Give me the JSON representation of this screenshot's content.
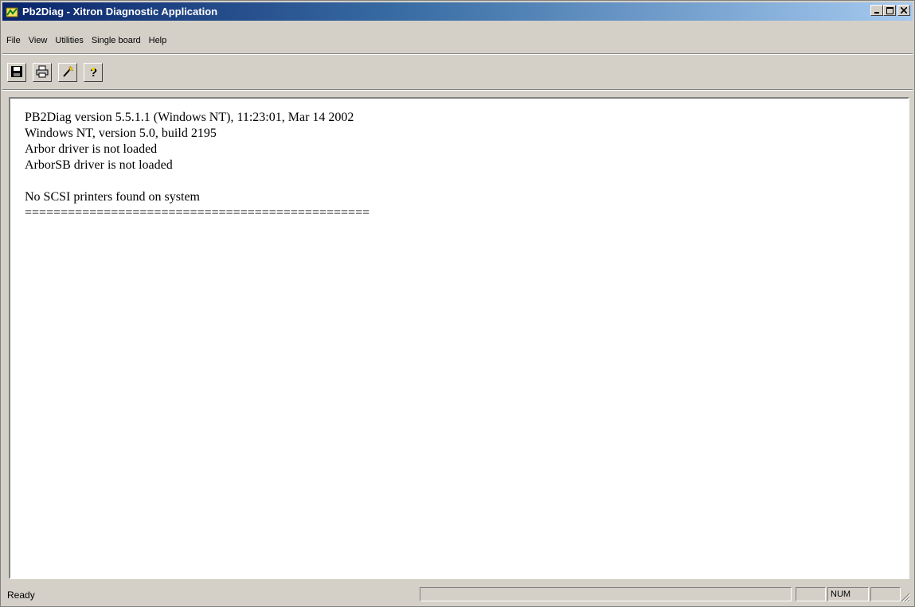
{
  "window": {
    "title": "Pb2Diag - Xitron Diagnostic Application"
  },
  "menu": [
    "File",
    "View",
    "Utilities",
    "Single board",
    "Help"
  ],
  "toolbar": {
    "buttons": [
      "save-icon",
      "print-icon",
      "wand-icon",
      "help-icon"
    ]
  },
  "output": {
    "lines": [
      "PB2Diag version 5.5.1.1 (Windows NT), 11:23:01, Mar 14 2002",
      "Windows NT, version 5.0, build 2195",
      "Arbor driver is not loaded",
      "ArborSB driver is not loaded",
      "",
      "No SCSI printers found on system",
      "================================================"
    ]
  },
  "status": {
    "text": "Ready",
    "num": "NUM"
  },
  "colors": {
    "title_start": "#0a246a",
    "title_end": "#a6caf0",
    "chrome": "#d4d0c8"
  }
}
